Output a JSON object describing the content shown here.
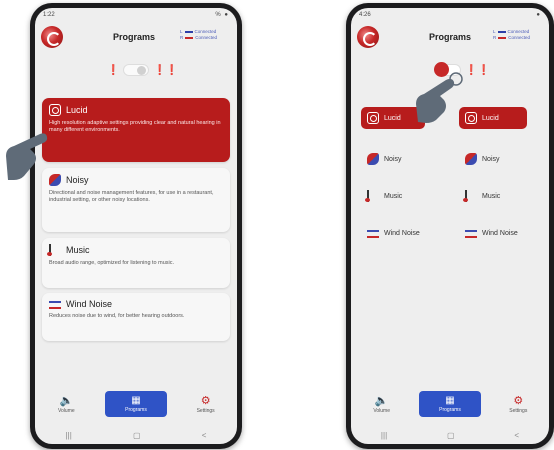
{
  "phone_left": {
    "status_time": "1:22",
    "status_right": "%  ●",
    "title": "Programs",
    "connection": {
      "left_label": "Connected",
      "right_label": "Connected",
      "left_side": "L",
      "right_side": "R"
    },
    "programs": [
      {
        "name": "Lucid",
        "description": "High resolution adaptive settings providing clear and natural hearing in many different environments.",
        "active": true,
        "icon": "lucid-icon"
      },
      {
        "name": "Noisy",
        "description": "Directional and noise management features, for use in a restaurant, industrial setting, or other noisy locations.",
        "active": false,
        "icon": "noisy-icon"
      },
      {
        "name": "Music",
        "description": "Broad audio range, optimized for listening to music.",
        "active": false,
        "icon": "music-icon"
      },
      {
        "name": "Wind Noise",
        "description": "Reduces noise due to wind, for better hearing outdoors.",
        "active": false,
        "icon": "wind-icon"
      }
    ],
    "nav": [
      {
        "label": "Volume",
        "icon": "speaker-icon",
        "active": false
      },
      {
        "label": "Programs",
        "icon": "grid-icon",
        "active": true
      },
      {
        "label": "Settings",
        "icon": "gear-icon",
        "active": false
      }
    ],
    "system": [
      "|||",
      "▢",
      "<"
    ]
  },
  "phone_right": {
    "status_time": "4:26",
    "status_right": "●",
    "title": "Programs",
    "connection": {
      "left_label": "Connected",
      "right_label": "Connected",
      "left_side": "L",
      "right_side": "R"
    },
    "left_column": [
      "Lucid",
      "Noisy",
      "Music",
      "Wind Noise"
    ],
    "right_column": [
      "Lucid",
      "Noisy",
      "Music",
      "Wind Noise"
    ],
    "nav": [
      {
        "label": "Volume",
        "icon": "speaker-icon",
        "active": false
      },
      {
        "label": "Programs",
        "icon": "grid-icon",
        "active": true
      },
      {
        "label": "Settings",
        "icon": "gear-icon",
        "active": false
      }
    ],
    "system": [
      "|||",
      "▢",
      "<"
    ]
  },
  "colors": {
    "accent_red": "#b71c1c",
    "nav_blue": "#2f53c6",
    "phone_body": "#1c1c1e"
  }
}
